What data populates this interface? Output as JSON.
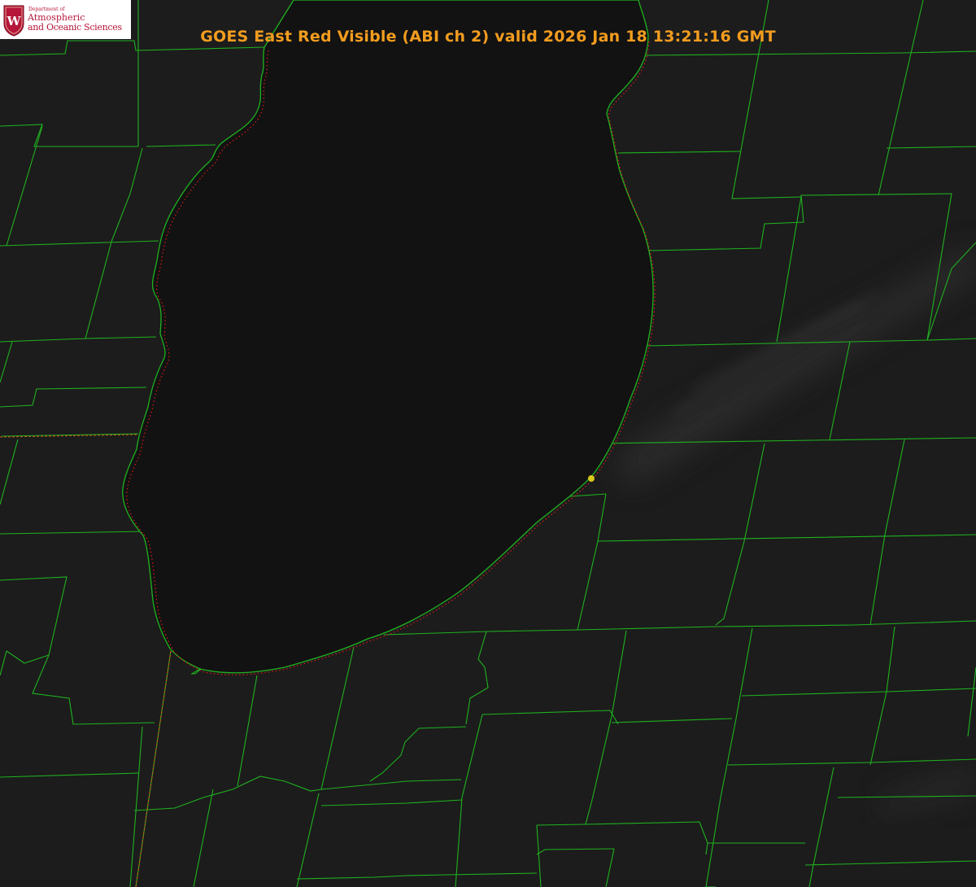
{
  "title": "GOES East Red Visible (ABI ch 2) valid 2026 Jan 18 13:21:16 GMT",
  "logo": {
    "department": "Department of",
    "line1": "Atmospheric",
    "line2": "and Oceanic Sciences",
    "seal_letter": "W"
  },
  "colors": {
    "title": "#f39c1f",
    "land": "#1c1c1c",
    "lake": "#121212",
    "county_boundary": "#1fb21f",
    "state_boundary": "#c85a14",
    "shoreline_dots": "#e01818",
    "marker": "#d8c81a",
    "logo_text": "#b5163a",
    "seal": "#b5163a"
  },
  "features": {
    "marker_icon": "yellow-dot-icon",
    "body_of_water": "lake"
  }
}
